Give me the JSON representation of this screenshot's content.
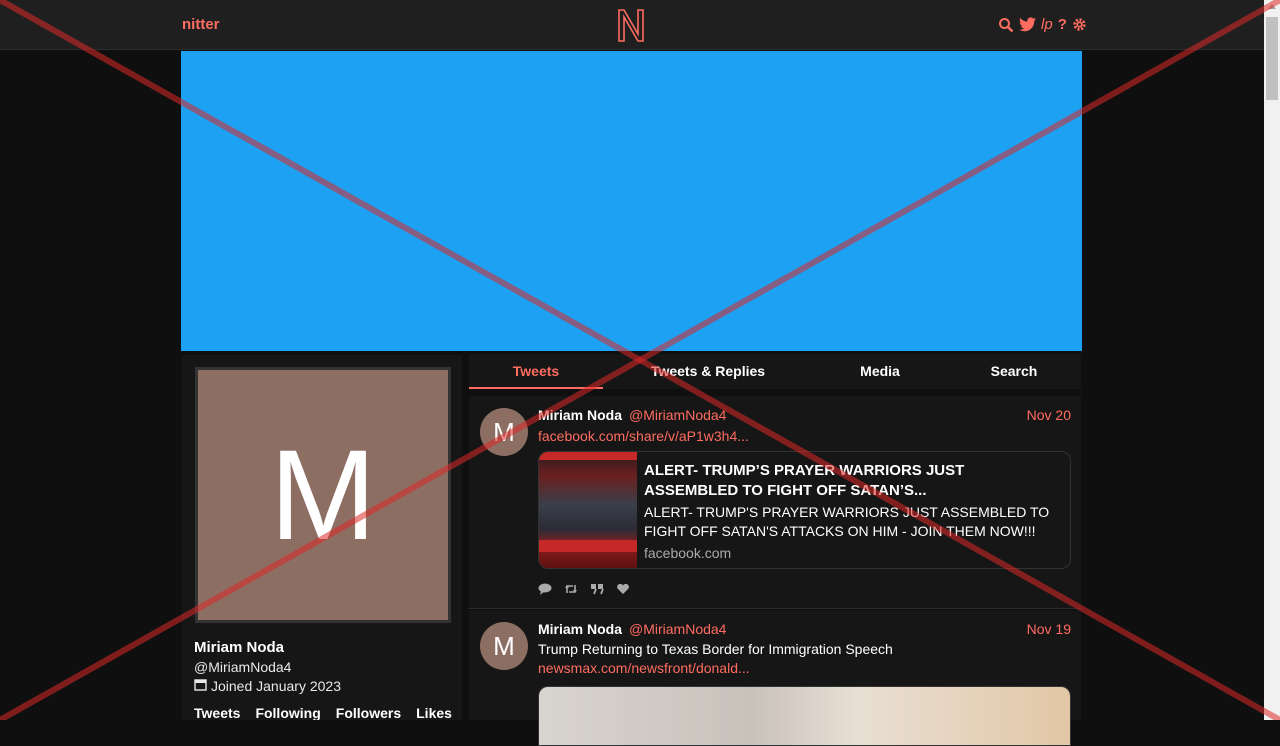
{
  "navbar": {
    "brand": "nitter",
    "icons": [
      "search-icon",
      "twitter-icon",
      "lp-icon",
      "help-icon",
      "gear-icon"
    ],
    "lp_text": "lp",
    "help_text": "?"
  },
  "colors": {
    "accent": "#ff6c60",
    "banner": "#1da1f2",
    "avatar": "#8d6e63",
    "background": "#0f0f0f",
    "panel": "#161616"
  },
  "profile": {
    "initial": "M",
    "name": "Miriam Noda",
    "handle": "@MiriamNoda4",
    "joined": "Joined January 2023",
    "stats": [
      "Tweets",
      "Following",
      "Followers",
      "Likes"
    ]
  },
  "tabs": [
    {
      "label": "Tweets",
      "active": true
    },
    {
      "label": "Tweets & Replies",
      "active": false
    },
    {
      "label": "Media",
      "active": false
    },
    {
      "label": "Search",
      "active": false
    }
  ],
  "tweets": [
    {
      "initial": "M",
      "name": "Miriam Noda",
      "handle": "@MiriamNoda4",
      "date": "Nov 20",
      "link": "facebook.com/share/v/aP1w3h4...",
      "card": {
        "title": "ALERT- TRUMP’S PRAYER WARRIORS JUST ASSEMBLED TO FIGHT OFF SATAN’S...",
        "description": "ALERT- TRUMP'S PRAYER WARRIORS JUST ASSEMBLED TO FIGHT OFF SATAN'S ATTACKS ON HIM - JOIN THEM NOW!!!",
        "domain": "facebook.com"
      }
    },
    {
      "initial": "M",
      "name": "Miriam Noda",
      "handle": "@MiriamNoda4",
      "date": "Nov 19",
      "text": "Trump Returning to Texas Border for Immigration Speech",
      "link": "newsmax.com/newsfront/donald..."
    }
  ]
}
